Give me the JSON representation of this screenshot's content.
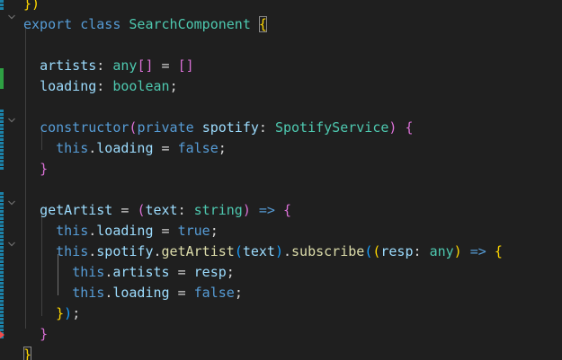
{
  "editor": {
    "lines": [
      {
        "tokens": [
          {
            "t": "})",
            "c": "br1"
          }
        ]
      },
      {
        "tokens": [
          {
            "t": "export",
            "c": "kw"
          },
          {
            "t": " "
          },
          {
            "t": "class",
            "c": "kw"
          },
          {
            "t": " "
          },
          {
            "t": "SearchComponent",
            "c": "cls"
          },
          {
            "t": " "
          },
          {
            "t": "{",
            "c": "br1 br-match"
          }
        ]
      },
      {
        "tokens": []
      },
      {
        "tokens": [
          {
            "t": "  "
          },
          {
            "t": "artists",
            "c": "prop"
          },
          {
            "t": ": "
          },
          {
            "t": "any",
            "c": "ty"
          },
          {
            "t": "[]",
            "c": "br2"
          },
          {
            "t": " = "
          },
          {
            "t": "[]",
            "c": "br2"
          }
        ]
      },
      {
        "tokens": [
          {
            "t": "  "
          },
          {
            "t": "loading",
            "c": "prop"
          },
          {
            "t": ": "
          },
          {
            "t": "boolean",
            "c": "ty"
          },
          {
            "t": ";"
          }
        ]
      },
      {
        "tokens": []
      },
      {
        "tokens": [
          {
            "t": "  "
          },
          {
            "t": "constructor",
            "c": "kw"
          },
          {
            "t": "(",
            "c": "br2"
          },
          {
            "t": "private",
            "c": "kw"
          },
          {
            "t": " "
          },
          {
            "t": "spotify",
            "c": "prop"
          },
          {
            "t": ": "
          },
          {
            "t": "SpotifyService",
            "c": "cls"
          },
          {
            "t": ")",
            "c": "br2"
          },
          {
            "t": " "
          },
          {
            "t": "{",
            "c": "br2"
          }
        ]
      },
      {
        "tokens": [
          {
            "t": "    "
          },
          {
            "t": "this",
            "c": "this"
          },
          {
            "t": "."
          },
          {
            "t": "loading",
            "c": "prop"
          },
          {
            "t": " = "
          },
          {
            "t": "false",
            "c": "boolv"
          },
          {
            "t": ";"
          }
        ]
      },
      {
        "tokens": [
          {
            "t": "  "
          },
          {
            "t": "}",
            "c": "br2"
          }
        ]
      },
      {
        "tokens": []
      },
      {
        "tokens": [
          {
            "t": "  "
          },
          {
            "t": "getArtist",
            "c": "prop"
          },
          {
            "t": " = "
          },
          {
            "t": "(",
            "c": "br2"
          },
          {
            "t": "text",
            "c": "prop"
          },
          {
            "t": ": "
          },
          {
            "t": "string",
            "c": "ty"
          },
          {
            "t": ")",
            "c": "br2"
          },
          {
            "t": " "
          },
          {
            "t": "=>",
            "c": "arrow"
          },
          {
            "t": " "
          },
          {
            "t": "{",
            "c": "br2"
          }
        ]
      },
      {
        "tokens": [
          {
            "t": "    "
          },
          {
            "t": "this",
            "c": "this"
          },
          {
            "t": "."
          },
          {
            "t": "loading",
            "c": "prop"
          },
          {
            "t": " = "
          },
          {
            "t": "true",
            "c": "boolv"
          },
          {
            "t": ";"
          }
        ]
      },
      {
        "tokens": [
          {
            "t": "    "
          },
          {
            "t": "this",
            "c": "this"
          },
          {
            "t": "."
          },
          {
            "t": "spotify",
            "c": "prop"
          },
          {
            "t": "."
          },
          {
            "t": "getArtist",
            "c": "fn"
          },
          {
            "t": "(",
            "c": "br3"
          },
          {
            "t": "text",
            "c": "prop"
          },
          {
            "t": ")",
            "c": "br3"
          },
          {
            "t": "."
          },
          {
            "t": "subscribe",
            "c": "fn"
          },
          {
            "t": "(",
            "c": "br3"
          },
          {
            "t": "(",
            "c": "br1"
          },
          {
            "t": "resp",
            "c": "prop"
          },
          {
            "t": ": "
          },
          {
            "t": "any",
            "c": "ty"
          },
          {
            "t": ")",
            "c": "br1"
          },
          {
            "t": " "
          },
          {
            "t": "=>",
            "c": "arrow"
          },
          {
            "t": " "
          },
          {
            "t": "{",
            "c": "br1"
          }
        ]
      },
      {
        "tokens": [
          {
            "t": "      "
          },
          {
            "t": "this",
            "c": "this"
          },
          {
            "t": "."
          },
          {
            "t": "artists",
            "c": "prop"
          },
          {
            "t": " = "
          },
          {
            "t": "resp",
            "c": "prop"
          },
          {
            "t": ";"
          }
        ]
      },
      {
        "tokens": [
          {
            "t": "      "
          },
          {
            "t": "this",
            "c": "this"
          },
          {
            "t": "."
          },
          {
            "t": "loading",
            "c": "prop"
          },
          {
            "t": " = "
          },
          {
            "t": "false",
            "c": "boolv"
          },
          {
            "t": ";"
          }
        ]
      },
      {
        "tokens": [
          {
            "t": "    "
          },
          {
            "t": "}",
            "c": "br1"
          },
          {
            "t": ")",
            "c": "br3"
          },
          {
            "t": ";"
          }
        ]
      },
      {
        "tokens": [
          {
            "t": "  "
          },
          {
            "t": "}",
            "c": "br2"
          }
        ]
      },
      {
        "tokens": [
          {
            "t": "}",
            "c": "br1 br-match"
          }
        ]
      }
    ],
    "colors": {
      "background": "#1f1f1f",
      "keyword": "#569cd6",
      "type": "#4ec9b0",
      "property": "#9cdcfe",
      "function": "#dcdcaa",
      "bracket_gold": "#ffd700",
      "bracket_orchid": "#da70d6",
      "bracket_blue": "#179fff",
      "git_modified": "#1b81a8",
      "git_added": "#2ea043",
      "git_deleted": "#f14c4c"
    },
    "fold_icons": [
      "chevron-down-icon"
    ]
  }
}
